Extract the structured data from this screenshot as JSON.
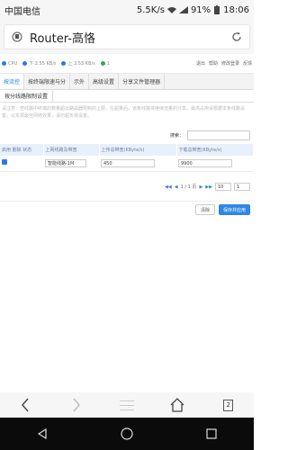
{
  "status": {
    "carrier": "中国电信",
    "speed": "5.5K/s",
    "battery": "91%",
    "time": "18:06"
  },
  "address": {
    "title": "Router-高恪"
  },
  "router": {
    "stats": [
      "CPU",
      "下 2.55 KB/s",
      "上 2.53 KB/s",
      "1"
    ],
    "top_links": [
      "退出",
      "帮助",
      "修改登录",
      "反馈"
    ],
    "tabs": [
      "按流控",
      "按终端限速与分",
      "示外",
      "高级设置",
      "分享文件管理器"
    ],
    "subtabs": [
      "按分线路限制设置"
    ],
    "description": "请注意：若线路中终端的数量超出路由器限制的上限，在超量后，该条线路将继续流量的分享。最高占用请根据本条线路设置，以实现最佳网络效果，请勿超负荷设置。",
    "search_label": "搜索：",
    "table": {
      "headers": [
        "启用 删除 状态",
        "上网线路及带宽",
        "上传总带宽(KByte/s)",
        "下载总带宽(KByte/s)"
      ],
      "rows": [
        {
          "line": "智能线路-1M",
          "upload": "450",
          "download": "9900"
        }
      ]
    },
    "pager": {
      "info": "1 / 1 页",
      "page_size": "10",
      "page": "1"
    },
    "buttons": {
      "clear": "清除",
      "save": "保存并应用"
    }
  },
  "browser_nav": {
    "tab_count": "2"
  }
}
